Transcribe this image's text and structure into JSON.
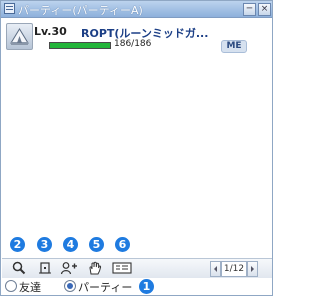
{
  "window": {
    "title": "パーティー(パーティーA)",
    "close_label": "×",
    "minimize_label": "─"
  },
  "member": {
    "level": "Lv.30",
    "name": "ROPT(ルーンミッドガ...",
    "hp_text": "186/186",
    "hp_fraction": 1.0,
    "me_badge": "ME"
  },
  "callouts": [
    "2",
    "3",
    "4",
    "5",
    "6",
    "1"
  ],
  "toolbar": {
    "icons": [
      "search-icon",
      "leave-icon",
      "invite-icon",
      "hand-icon",
      "party-settings-icon"
    ],
    "page": "1/12"
  },
  "tabs": {
    "friends": "友達",
    "party": "パーティー"
  },
  "colors": {
    "title_bar": "#8db0db",
    "hp": "#23b53a",
    "callout": "#1f7be0"
  }
}
